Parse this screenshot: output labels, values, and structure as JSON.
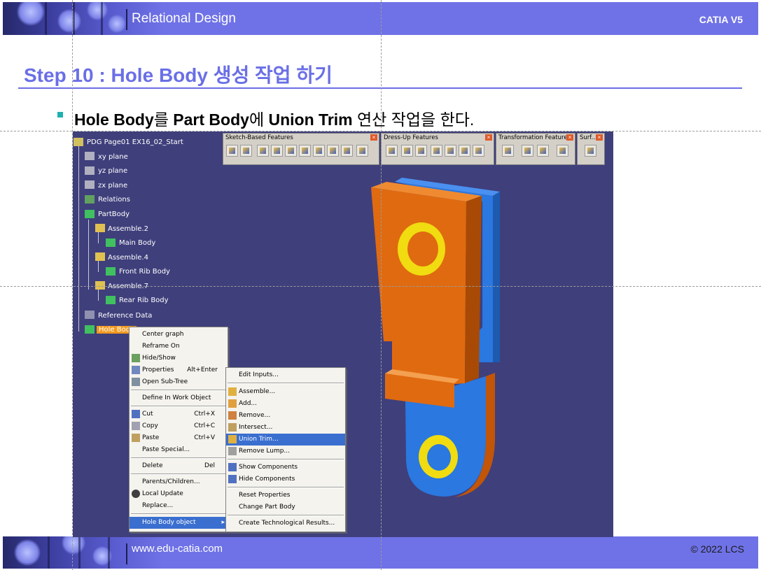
{
  "header": {
    "title": "Relational Design",
    "product": "CATIA V5"
  },
  "footer": {
    "url": "www.edu-catia.com",
    "copyright": "© 2022 LCS"
  },
  "slide": {
    "title": "Step 10 : Hole Body 생성 작업 하기",
    "bullet": {
      "b1": "Hole Body",
      "t1": "를 ",
      "b2": "Part Body",
      "t2": "에 ",
      "b3": "Union Trim",
      "t3": " 연산 작업을 한다."
    }
  },
  "tree": {
    "root": "PDG Page01 EX16_02_Start",
    "xy": "xy plane",
    "yz": "yz plane",
    "zx": "zx plane",
    "relations": "Relations",
    "partbody": "PartBody",
    "assemble2": "Assemble.2",
    "main_body": "Main Body",
    "assemble4": "Assemble.4",
    "front_rib": "Front Rib Body",
    "assemble7": "Assemble.7",
    "rear_rib": "Rear Rib Body",
    "reference": "Reference Data",
    "hole_body": "Hole Body"
  },
  "toolbars": {
    "sketch": "Sketch-Based Features",
    "dressup": "Dress-Up Features",
    "transform": "Transformation Features",
    "surf": "Surf..."
  },
  "context_menu": {
    "center_graph": "Center graph",
    "reframe_on": "Reframe On",
    "hide_show": "Hide/Show",
    "properties": "Properties",
    "properties_acc": "Alt+Enter",
    "open_subtree": "Open Sub-Tree",
    "define_in_work": "Define In Work Object",
    "cut": "Cut",
    "cut_acc": "Ctrl+X",
    "copy": "Copy",
    "copy_acc": "Ctrl+C",
    "paste": "Paste",
    "paste_acc": "Ctrl+V",
    "paste_special": "Paste Special...",
    "delete": "Delete",
    "delete_acc": "Del",
    "parents_children": "Parents/Children...",
    "local_update": "Local Update",
    "replace": "Replace...",
    "hole_body_object": "Hole Body object"
  },
  "submenu": {
    "edit_inputs": "Edit Inputs...",
    "assemble": "Assemble...",
    "add": "Add...",
    "remove": "Remove...",
    "intersect": "Intersect...",
    "union_trim": "Union Trim...",
    "remove_lump": "Remove Lump...",
    "show_components": "Show Components",
    "hide_components": "Hide Components",
    "reset_properties": "Reset Properties",
    "change_part_body": "Change Part Body",
    "create_tech_results": "Create Technological Results..."
  },
  "colors": {
    "accent": "#6a6fe6",
    "viewport_bg": "#3f3f7c",
    "part_orange": "#e06a10",
    "part_blue": "#2a78e0",
    "ring_yellow": "#f0dc10",
    "menu_highlight": "#3a6fd0"
  }
}
